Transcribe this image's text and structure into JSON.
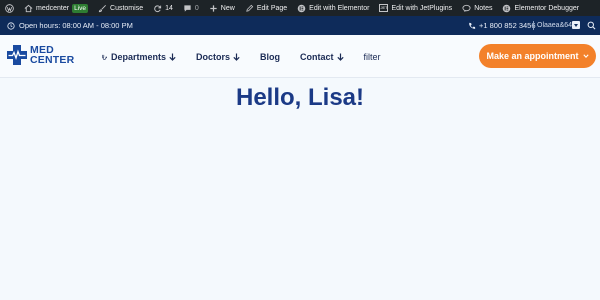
{
  "admin_bar": {
    "site_name": "medcenter",
    "live_badge": "Live",
    "customise": "Customise",
    "updates_count": "14",
    "comments_count": "0",
    "new_label": "New",
    "edit_page": "Edit Page",
    "edit_elementor": "Edit with Elementor",
    "edit_jet": "Edit with JetPlugins",
    "notes": "Notes",
    "debugger": "Elementor Debugger"
  },
  "info_bar": {
    "hours": "Open hours: 08:00 AM - 08:00 PM",
    "phone": "+1 800 852 3456",
    "partial_text": "Olaaea&64"
  },
  "header": {
    "logo_line1": "MED",
    "logo_line2": "CENTER",
    "nav": {
      "departments": "Departments",
      "doctors": "Doctors",
      "blog": "Blog",
      "contact": "Contact",
      "filter": "filter"
    },
    "cta": "Make an appointment"
  },
  "main": {
    "greeting": "Hello, Lisa!"
  },
  "colors": {
    "admin_bar": "#1d2327",
    "info_bar": "#0e2b5a",
    "accent": "#f3812a",
    "brand_blue": "#1a4aa0",
    "heading": "#1b3a86"
  }
}
